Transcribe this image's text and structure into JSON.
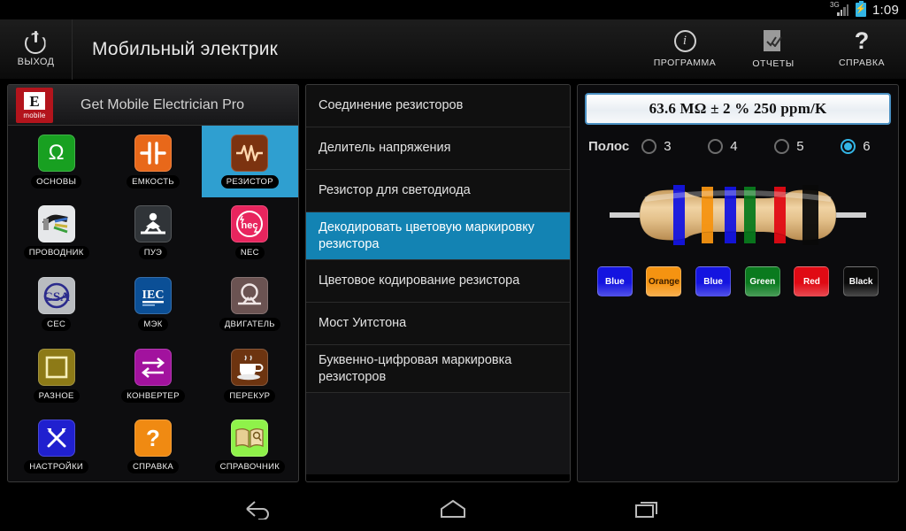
{
  "statusbar": {
    "network": "3G",
    "time": "1:09",
    "battery_icon": "battery-charging-icon"
  },
  "actionbar": {
    "exit_label": "ВЫХОД",
    "title": "Мобильный электрик",
    "actions": [
      {
        "label": "ПРОГРАММА",
        "icon": "info-icon"
      },
      {
        "label": "ОТЧЕТЫ",
        "icon": "report-check-icon"
      },
      {
        "label": "СПРАВКА",
        "icon": "question-mark-icon"
      }
    ]
  },
  "left_panel": {
    "logo_letter": "E",
    "logo_sub": "mobile",
    "title": "Get Mobile Electrician Pro",
    "tiles": [
      {
        "label": "ОСНОВЫ",
        "icon": "omega-icon",
        "color": "#18a021",
        "glyph": "Ω",
        "selected": false
      },
      {
        "label": "ЕМКОСТЬ",
        "icon": "capacitor-icon",
        "color": "#e8681a",
        "glyph": "",
        "selected": false
      },
      {
        "label": "РЕЗИСТОР",
        "icon": "resistor-icon",
        "color": "#7c3310",
        "glyph": "",
        "selected": true
      },
      {
        "label": "ПРОВОДНИК",
        "icon": "cable-icon",
        "color": "#e6e8ea",
        "glyph": "",
        "selected": false
      },
      {
        "label": "ПУЭ",
        "icon": "electrician-icon",
        "color": "#303438",
        "glyph": "",
        "selected": false
      },
      {
        "label": "NEC",
        "icon": "nec-badge-icon",
        "color": "#e8255e",
        "glyph": "",
        "selected": false
      },
      {
        "label": "CEC",
        "icon": "csa-badge-icon",
        "color": "#b9bcc0",
        "glyph": "",
        "selected": false
      },
      {
        "label": "МЭК",
        "icon": "iec-badge-icon",
        "color": "#0b4f96",
        "glyph": "",
        "selected": false
      },
      {
        "label": "ДВИГАТЕЛЬ",
        "icon": "motor-icon",
        "color": "#6b5352",
        "glyph": "",
        "selected": false
      },
      {
        "label": "РАЗНОЕ",
        "icon": "square-icon",
        "color": "#8d7a17",
        "glyph": "",
        "selected": false
      },
      {
        "label": "КОНВЕРТЕР",
        "icon": "converter-icon",
        "color": "#a2129e",
        "glyph": "",
        "selected": false
      },
      {
        "label": "ПЕРЕКУР",
        "icon": "coffee-cup-icon",
        "color": "#6d3410",
        "glyph": "",
        "selected": false
      },
      {
        "label": "НАСТРОЙКИ",
        "icon": "tools-icon",
        "color": "#2020cf",
        "glyph": "",
        "selected": false
      },
      {
        "label": "СПРАВКА",
        "icon": "question-icon",
        "color": "#f08a12",
        "glyph": "?",
        "selected": false
      },
      {
        "label": "СПРАВОЧНИК",
        "icon": "book-icon",
        "color": "#8ff24a",
        "glyph": "",
        "selected": false
      }
    ]
  },
  "menu": {
    "items": [
      {
        "label": "Соединение резисторов",
        "active": false
      },
      {
        "label": "Делитель напряжения",
        "active": false
      },
      {
        "label": "Резистор для светодиода",
        "active": false
      },
      {
        "label": "Декодировать цветовую маркировку резистора",
        "active": true
      },
      {
        "label": "Цветовое кодирование резистора",
        "active": false
      },
      {
        "label": "Мост Уитстона",
        "active": false
      },
      {
        "label": "Буквенно-цифровая маркировка резисторов",
        "active": false
      }
    ]
  },
  "decoder": {
    "result": "63.6 MΩ ± 2 % 250 ppm/K",
    "bands_label": "Полос",
    "band_count_options": [
      {
        "value": "3",
        "selected": false
      },
      {
        "value": "4",
        "selected": false
      },
      {
        "value": "5",
        "selected": false
      },
      {
        "value": "6",
        "selected": true
      }
    ],
    "bands": [
      {
        "name": "Blue",
        "color": "#1414e0",
        "text": "#ffffff"
      },
      {
        "name": "Orange",
        "color": "#f59311",
        "text": "#3a1d00"
      },
      {
        "name": "Blue",
        "color": "#1414e0",
        "text": "#ffffff"
      },
      {
        "name": "Green",
        "color": "#0a7a1e",
        "text": "#ffffff"
      },
      {
        "name": "Red",
        "color": "#e00a14",
        "text": "#ffffff"
      },
      {
        "name": "Black",
        "color": "#0a0a0a",
        "text": "#ffffff"
      }
    ],
    "body_color": "#e3c08a"
  },
  "navbar": {
    "buttons": [
      {
        "name": "back-icon"
      },
      {
        "name": "home-icon"
      },
      {
        "name": "recents-icon"
      }
    ]
  }
}
